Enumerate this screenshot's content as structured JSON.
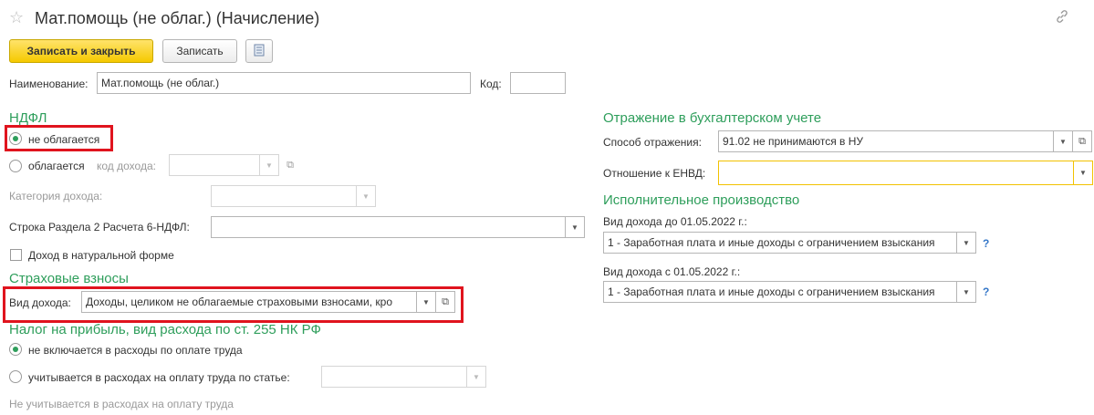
{
  "window": {
    "title": "Мат.помощь (не облаг.) (Начисление)"
  },
  "toolbar": {
    "save_close_label": "Записать и закрыть",
    "save_label": "Записать"
  },
  "header": {
    "name_label": "Наименование:",
    "name_value": "Мат.помощь (не облаг.)",
    "code_label": "Код:",
    "code_value": ""
  },
  "ndfl": {
    "group_title": "НДФЛ",
    "not_taxed_label": "не облагается",
    "taxed_label": "облагается",
    "income_code_label": "код дохода:",
    "income_category_label": "Категория дохода:",
    "line_6ndfl_label": "Строка Раздела 2 Расчета 6-НДФЛ:",
    "line_6ndfl_value": "",
    "in_kind_label": "Доход в натуральной форме",
    "selected": "not_taxed"
  },
  "insurance": {
    "group_title": "Страховые взносы",
    "income_type_label": "Вид дохода:",
    "income_type_value": "Доходы, целиком не облагаемые страховыми взносами, кро"
  },
  "profit_tax": {
    "group_title": "Налог на прибыль, вид расхода по ст. 255 НК РФ",
    "not_included_label": "не включается в расходы по оплате труда",
    "included_label": "учитывается в расходах на оплату труда по статье:",
    "note": "Не учитывается в расходах на оплату труда",
    "selected": "not_included"
  },
  "accounting": {
    "group_title": "Отражение в бухгалтерском учете",
    "method_label": "Способ отражения:",
    "method_value": "91.02 не принимаются в НУ",
    "envd_label": "Отношение к ЕНВД:",
    "envd_value": ""
  },
  "enforcement": {
    "group_title": "Исполнительное производство",
    "before_label": "Вид дохода до 01.05.2022 г.:",
    "before_value": "1 - Заработная плата и иные доходы с ограничением взыскания",
    "after_label": "Вид дохода с 01.05.2022 г.:",
    "after_value": "1 - Заработная плата и иные доходы с ограничением взыскания",
    "help_symbol": "?"
  },
  "colors": {
    "accent_green": "#2e9e5b",
    "primary_button": "#f5c900",
    "highlight_red": "#e0141e",
    "help_blue": "#3577c8"
  }
}
